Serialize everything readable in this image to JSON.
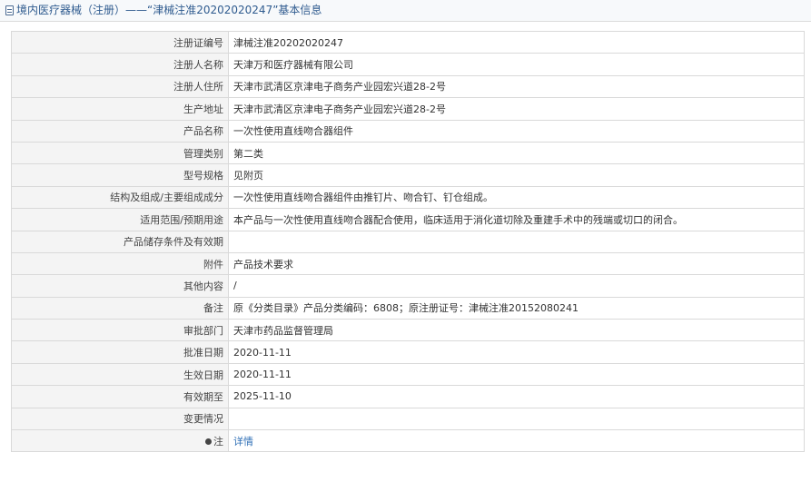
{
  "header": {
    "icon": "document-icon",
    "title": "境内医疗器械（注册）——“津械注准20202020247”基本信息"
  },
  "rows": [
    {
      "label": "注册证编号",
      "value": "津械注准20202020247"
    },
    {
      "label": "注册人名称",
      "value": "天津万和医疗器械有限公司"
    },
    {
      "label": "注册人住所",
      "value": "天津市武清区京津电子商务产业园宏兴道28-2号"
    },
    {
      "label": "生产地址",
      "value": "天津市武清区京津电子商务产业园宏兴道28-2号"
    },
    {
      "label": "产品名称",
      "value": "一次性使用直线吻合器组件"
    },
    {
      "label": "管理类别",
      "value": "第二类"
    },
    {
      "label": "型号规格",
      "value": "见附页"
    },
    {
      "label": "结构及组成/主要组成成分",
      "value": "一次性使用直线吻合器组件由推钉片、吻合钉、钉仓组成。"
    },
    {
      "label": "适用范围/预期用途",
      "value": "本产品与一次性使用直线吻合器配合使用，临床适用于消化道切除及重建手术中的残端或切口的闭合。"
    },
    {
      "label": "产品储存条件及有效期",
      "value": ""
    },
    {
      "label": "附件",
      "value": "产品技术要求"
    },
    {
      "label": "其他内容",
      "value": "/"
    },
    {
      "label": "备注",
      "value": "原《分类目录》产品分类编码：6808；原注册证号：津械注准20152080241"
    },
    {
      "label": "审批部门",
      "value": "天津市药品监督管理局"
    },
    {
      "label": "批准日期",
      "value": "2020-11-11"
    },
    {
      "label": "生效日期",
      "value": "2020-11-11"
    },
    {
      "label": "有效期至",
      "value": "2025-11-10"
    },
    {
      "label": "变更情况",
      "value": ""
    }
  ],
  "note_row": {
    "label": "注",
    "icon": "bullet-icon",
    "link_text": "详情"
  }
}
